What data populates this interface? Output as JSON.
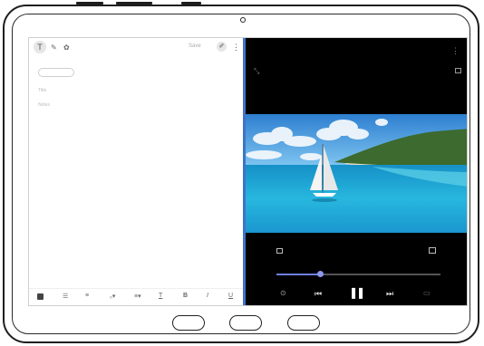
{
  "device": {
    "camera": "camera-icon"
  },
  "notes_app": {
    "toolbar": {
      "tool_icon": "T",
      "pen_icon": "✎",
      "brush_icon": "✿",
      "save_label": "Save",
      "attach_icon": "✐",
      "more_icon": "⋮"
    },
    "chip": "",
    "lines": [
      "Title",
      "Notes"
    ],
    "format_bar": [
      {
        "name": "bullet-list",
        "glyph": "☰"
      },
      {
        "name": "number-list",
        "glyph": "≡"
      },
      {
        "name": "font-size",
        "glyph": "₀▾"
      },
      {
        "name": "align",
        "glyph": "≡▾"
      },
      {
        "name": "text-color",
        "glyph": "T"
      },
      {
        "name": "bold",
        "glyph": "B"
      },
      {
        "name": "italic",
        "glyph": "I"
      },
      {
        "name": "underline",
        "glyph": "U"
      }
    ]
  },
  "video_app": {
    "title": "",
    "more_icon": "⋮",
    "rotate_icon": "⤡",
    "time_current": "",
    "time_total": "",
    "progress": 0.27,
    "controls": {
      "lock_icon": "⊙",
      "prev_icon": "⏮",
      "pause_icon": "❚❚",
      "next_icon": "⏭",
      "extra_icon": "▭"
    }
  },
  "colors": {
    "divider": "#3e74c8",
    "seek": "#6f7fe0",
    "sky": "#3a8fd6",
    "sea": "#1fa8d8"
  }
}
